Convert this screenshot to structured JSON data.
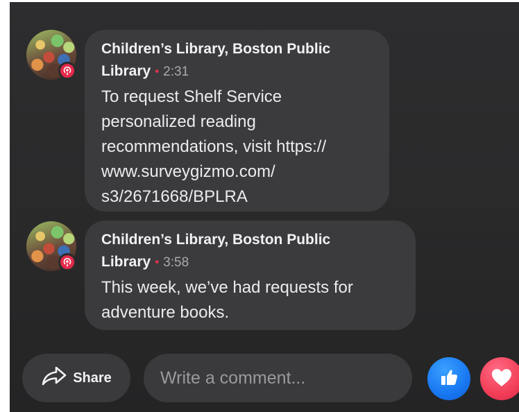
{
  "comments": [
    {
      "author_line1": "Children’s Library, Boston Public",
      "author_line2": "Library",
      "dot": "•",
      "time": "2:31",
      "text_lines": [
        "To request Shelf Service",
        "personalized reading",
        "recommendations, visit https://",
        "www.surveygizmo.com/",
        "s3/2671668/BPLRA"
      ]
    },
    {
      "author_line1": "Children’s Library, Boston Public",
      "author_line2": "Library",
      "dot": "•",
      "time": "3:58",
      "text_lines": [
        "This week, we’ve had requests for",
        "adventure books."
      ]
    }
  ],
  "actions": {
    "share_label": "Share",
    "comment_placeholder": "Write a comment..."
  },
  "icons": {
    "live_badge": "broadcast-icon",
    "share": "share-arrow-icon",
    "like": "thumbs-up-icon",
    "love": "heart-icon"
  },
  "colors": {
    "background": "#2a2a2b",
    "bubble": "#3b3b3d",
    "live_badge": "#e4294a",
    "like": "#1877f2",
    "love": "#f33e58",
    "dot": "#d9344f"
  }
}
